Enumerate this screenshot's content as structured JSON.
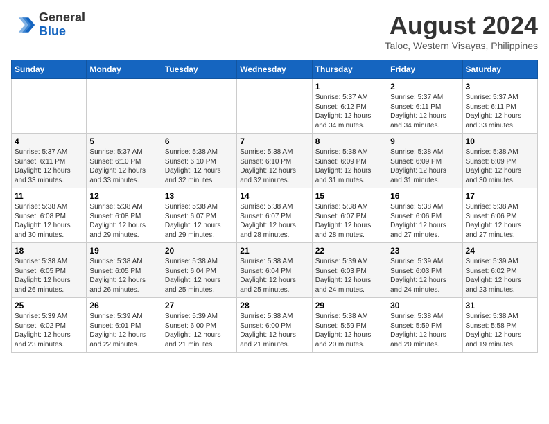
{
  "header": {
    "logo_line1": "General",
    "logo_line2": "Blue",
    "main_title": "August 2024",
    "subtitle": "Taloc, Western Visayas, Philippines"
  },
  "days_of_week": [
    "Sunday",
    "Monday",
    "Tuesday",
    "Wednesday",
    "Thursday",
    "Friday",
    "Saturday"
  ],
  "weeks": [
    [
      {
        "day": "",
        "info": ""
      },
      {
        "day": "",
        "info": ""
      },
      {
        "day": "",
        "info": ""
      },
      {
        "day": "",
        "info": ""
      },
      {
        "day": "1",
        "info": "Sunrise: 5:37 AM\nSunset: 6:12 PM\nDaylight: 12 hours\nand 34 minutes."
      },
      {
        "day": "2",
        "info": "Sunrise: 5:37 AM\nSunset: 6:11 PM\nDaylight: 12 hours\nand 34 minutes."
      },
      {
        "day": "3",
        "info": "Sunrise: 5:37 AM\nSunset: 6:11 PM\nDaylight: 12 hours\nand 33 minutes."
      }
    ],
    [
      {
        "day": "4",
        "info": "Sunrise: 5:37 AM\nSunset: 6:11 PM\nDaylight: 12 hours\nand 33 minutes."
      },
      {
        "day": "5",
        "info": "Sunrise: 5:37 AM\nSunset: 6:10 PM\nDaylight: 12 hours\nand 33 minutes."
      },
      {
        "day": "6",
        "info": "Sunrise: 5:38 AM\nSunset: 6:10 PM\nDaylight: 12 hours\nand 32 minutes."
      },
      {
        "day": "7",
        "info": "Sunrise: 5:38 AM\nSunset: 6:10 PM\nDaylight: 12 hours\nand 32 minutes."
      },
      {
        "day": "8",
        "info": "Sunrise: 5:38 AM\nSunset: 6:09 PM\nDaylight: 12 hours\nand 31 minutes."
      },
      {
        "day": "9",
        "info": "Sunrise: 5:38 AM\nSunset: 6:09 PM\nDaylight: 12 hours\nand 31 minutes."
      },
      {
        "day": "10",
        "info": "Sunrise: 5:38 AM\nSunset: 6:09 PM\nDaylight: 12 hours\nand 30 minutes."
      }
    ],
    [
      {
        "day": "11",
        "info": "Sunrise: 5:38 AM\nSunset: 6:08 PM\nDaylight: 12 hours\nand 30 minutes."
      },
      {
        "day": "12",
        "info": "Sunrise: 5:38 AM\nSunset: 6:08 PM\nDaylight: 12 hours\nand 29 minutes."
      },
      {
        "day": "13",
        "info": "Sunrise: 5:38 AM\nSunset: 6:07 PM\nDaylight: 12 hours\nand 29 minutes."
      },
      {
        "day": "14",
        "info": "Sunrise: 5:38 AM\nSunset: 6:07 PM\nDaylight: 12 hours\nand 28 minutes."
      },
      {
        "day": "15",
        "info": "Sunrise: 5:38 AM\nSunset: 6:07 PM\nDaylight: 12 hours\nand 28 minutes."
      },
      {
        "day": "16",
        "info": "Sunrise: 5:38 AM\nSunset: 6:06 PM\nDaylight: 12 hours\nand 27 minutes."
      },
      {
        "day": "17",
        "info": "Sunrise: 5:38 AM\nSunset: 6:06 PM\nDaylight: 12 hours\nand 27 minutes."
      }
    ],
    [
      {
        "day": "18",
        "info": "Sunrise: 5:38 AM\nSunset: 6:05 PM\nDaylight: 12 hours\nand 26 minutes."
      },
      {
        "day": "19",
        "info": "Sunrise: 5:38 AM\nSunset: 6:05 PM\nDaylight: 12 hours\nand 26 minutes."
      },
      {
        "day": "20",
        "info": "Sunrise: 5:38 AM\nSunset: 6:04 PM\nDaylight: 12 hours\nand 25 minutes."
      },
      {
        "day": "21",
        "info": "Sunrise: 5:38 AM\nSunset: 6:04 PM\nDaylight: 12 hours\nand 25 minutes."
      },
      {
        "day": "22",
        "info": "Sunrise: 5:39 AM\nSunset: 6:03 PM\nDaylight: 12 hours\nand 24 minutes."
      },
      {
        "day": "23",
        "info": "Sunrise: 5:39 AM\nSunset: 6:03 PM\nDaylight: 12 hours\nand 24 minutes."
      },
      {
        "day": "24",
        "info": "Sunrise: 5:39 AM\nSunset: 6:02 PM\nDaylight: 12 hours\nand 23 minutes."
      }
    ],
    [
      {
        "day": "25",
        "info": "Sunrise: 5:39 AM\nSunset: 6:02 PM\nDaylight: 12 hours\nand 23 minutes."
      },
      {
        "day": "26",
        "info": "Sunrise: 5:39 AM\nSunset: 6:01 PM\nDaylight: 12 hours\nand 22 minutes."
      },
      {
        "day": "27",
        "info": "Sunrise: 5:39 AM\nSunset: 6:00 PM\nDaylight: 12 hours\nand 21 minutes."
      },
      {
        "day": "28",
        "info": "Sunrise: 5:38 AM\nSunset: 6:00 PM\nDaylight: 12 hours\nand 21 minutes."
      },
      {
        "day": "29",
        "info": "Sunrise: 5:38 AM\nSunset: 5:59 PM\nDaylight: 12 hours\nand 20 minutes."
      },
      {
        "day": "30",
        "info": "Sunrise: 5:38 AM\nSunset: 5:59 PM\nDaylight: 12 hours\nand 20 minutes."
      },
      {
        "day": "31",
        "info": "Sunrise: 5:38 AM\nSunset: 5:58 PM\nDaylight: 12 hours\nand 19 minutes."
      }
    ]
  ]
}
